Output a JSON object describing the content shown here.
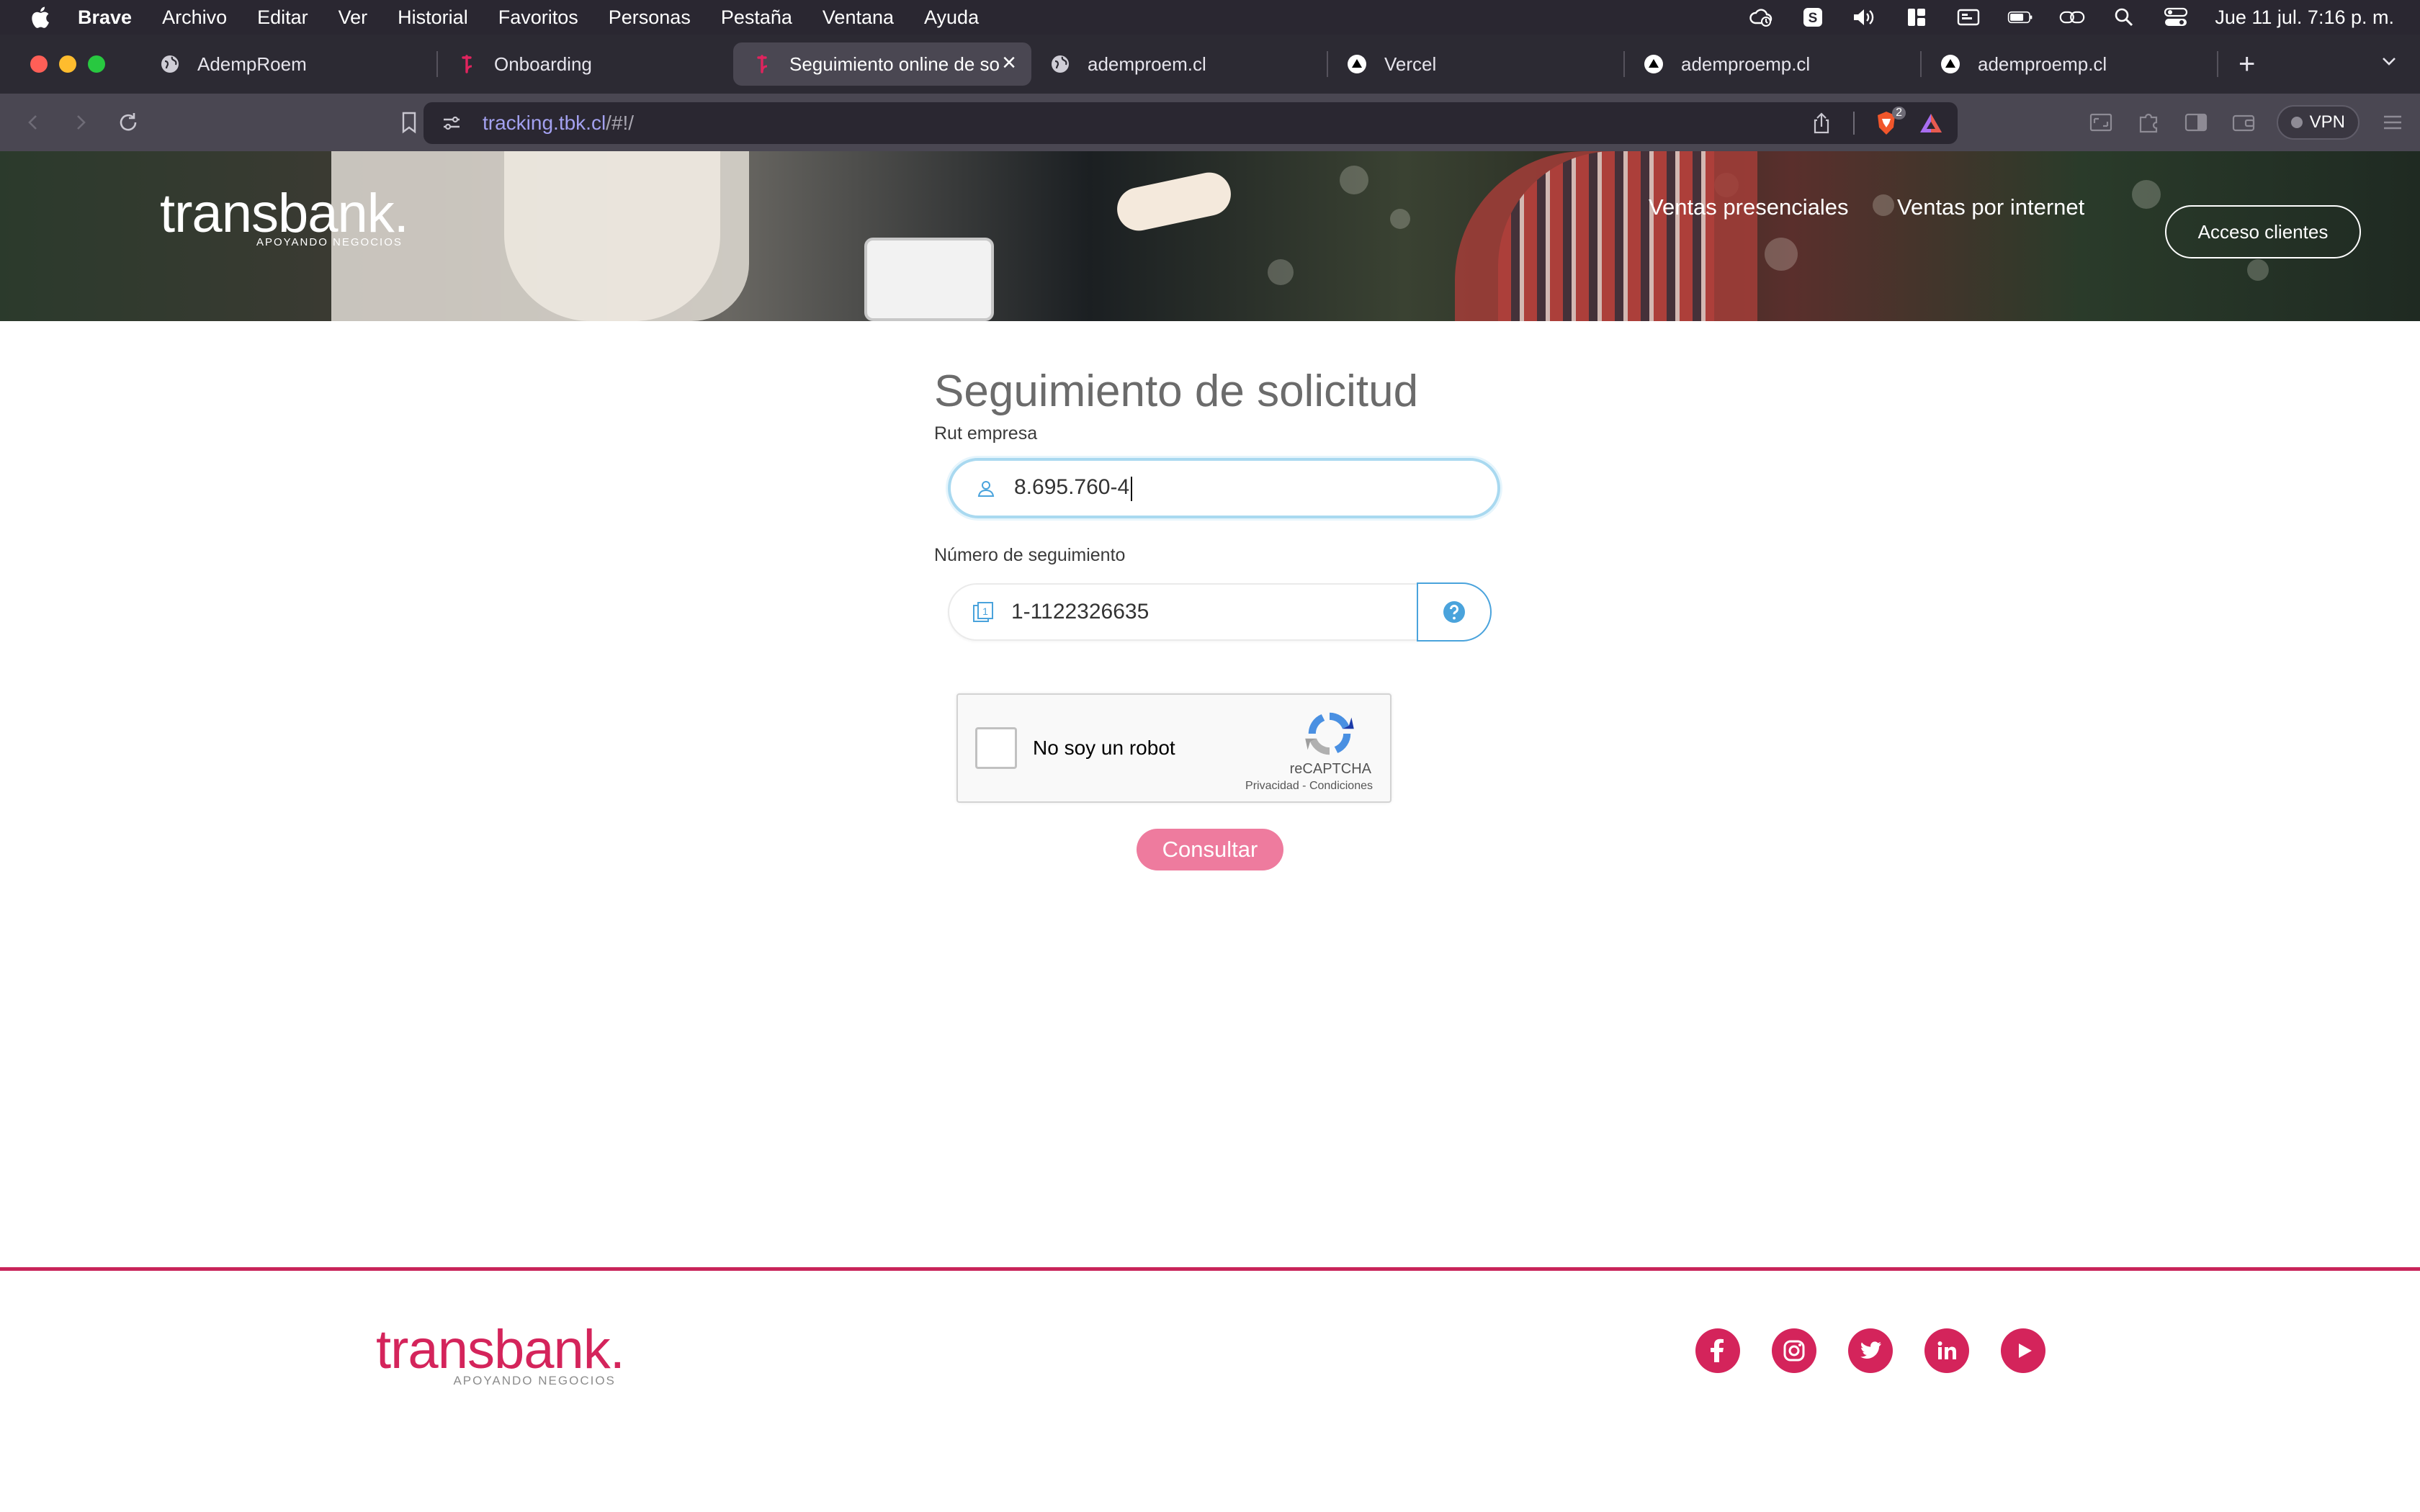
{
  "menubar": {
    "items": [
      "Brave",
      "Archivo",
      "Editar",
      "Ver",
      "Historial",
      "Favoritos",
      "Personas",
      "Pestaña",
      "Ventana",
      "Ayuda"
    ],
    "clock": "Jue 11 jul.  7:16 p. m.",
    "status_icons": [
      "cloud-sync-icon",
      "s-app-icon",
      "volume-icon",
      "grid-app-icon",
      "display-icon",
      "battery-icon",
      "link-icon",
      "spotlight-search-icon",
      "control-center-icon"
    ]
  },
  "tabs": [
    {
      "title": "AdempRoem",
      "icon": "globe-icon",
      "active": false
    },
    {
      "title": "Onboarding",
      "icon": "transbank-icon",
      "active": false
    },
    {
      "title": "Seguimiento online de so",
      "icon": "transbank-icon",
      "active": true
    },
    {
      "title": "ademproem.cl",
      "icon": "globe-icon",
      "active": false
    },
    {
      "title": "Vercel",
      "icon": "vercel-icon",
      "active": false
    },
    {
      "title": "ademproemp.cl",
      "icon": "vercel-icon",
      "active": false
    },
    {
      "title": "ademproemp.cl",
      "icon": "vercel-icon",
      "active": false
    }
  ],
  "newtab_label": "+",
  "address": {
    "host": "tracking.tbk.cl",
    "path": "/#!/",
    "shield_count": "2"
  },
  "vpn_label": "VPN",
  "hero": {
    "logo_text": "transbank.",
    "logo_tagline": "APOYANDO NEGOCIOS",
    "nav": [
      "Ventas presenciales",
      "Ventas por internet"
    ],
    "access_button": "Acceso clientes"
  },
  "form": {
    "title": "Seguimiento de solicitud",
    "rut_label": "Rut empresa",
    "rut_value": "8.695.760-4",
    "tracking_label": "Número de seguimiento",
    "tracking_value": "1-1122326635",
    "captcha_label": "No soy un robot",
    "captcha_brand": "reCAPTCHA",
    "captcha_links": "Privacidad - Condiciones",
    "submit_label": "Consultar"
  },
  "footer": {
    "logo_text": "transbank.",
    "logo_tagline": "APOYANDO NEGOCIOS",
    "social": [
      "facebook-icon",
      "instagram-icon",
      "twitter-icon",
      "linkedin-icon",
      "youtube-icon"
    ]
  },
  "colors": {
    "brand": "#d4245b",
    "button": "#ee7b9e",
    "focus": "#a9d9f0",
    "help": "#4aa3dc"
  }
}
